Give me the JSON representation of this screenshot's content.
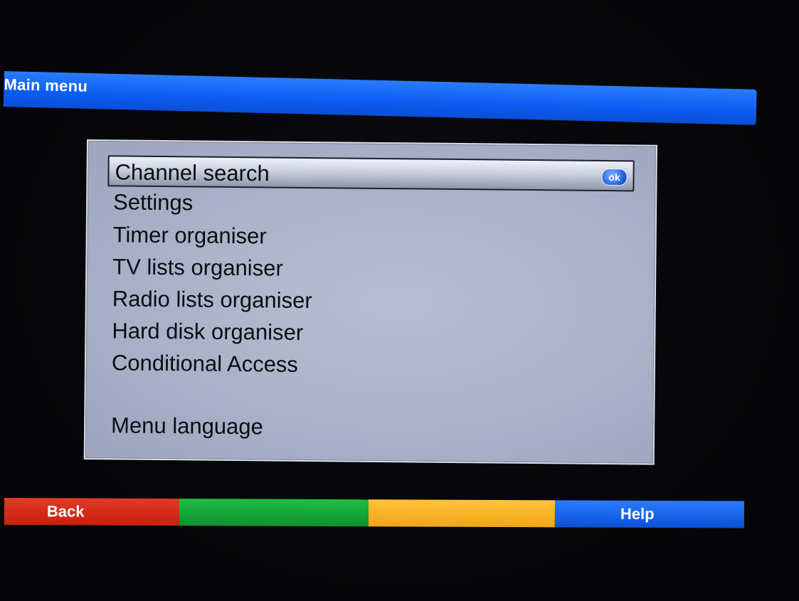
{
  "header": {
    "title": "Main menu"
  },
  "menu": {
    "items": [
      {
        "label": "Channel search",
        "selected": true
      },
      {
        "label": "Settings",
        "selected": false
      },
      {
        "label": "Timer organiser",
        "selected": false
      },
      {
        "label": "TV lists organiser",
        "selected": false
      },
      {
        "label": "Radio lists organiser",
        "selected": false
      },
      {
        "label": "Hard disk organiser",
        "selected": false
      },
      {
        "label": "Conditional Access",
        "selected": false
      },
      {
        "label": "Menu language",
        "selected": false
      }
    ],
    "ok_badge": "ok"
  },
  "color_keys": {
    "red": {
      "label": "Back",
      "color": "#d42a18"
    },
    "green": {
      "label": "",
      "color": "#17a838"
    },
    "yellow": {
      "label": "",
      "color": "#f8b32a"
    },
    "blue": {
      "label": "Help",
      "color": "#1a66ea"
    }
  },
  "colors": {
    "title_bar": "#0d5cf2",
    "panel": "#a9b2c8",
    "text": "#0b0d14"
  }
}
